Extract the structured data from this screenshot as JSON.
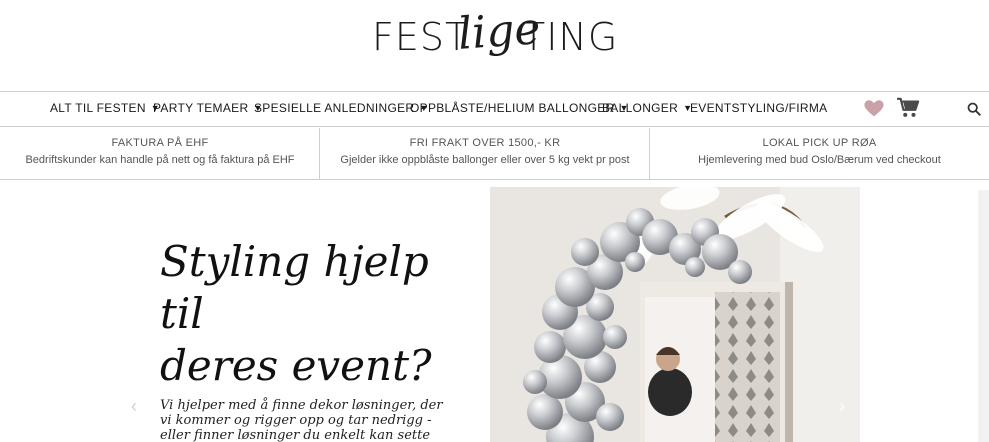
{
  "logo": {
    "part1": "FEST",
    "part2": "lige",
    "part3": "TING"
  },
  "nav": {
    "items": [
      {
        "label": "ALT TIL FESTEN",
        "caret": true
      },
      {
        "label": "PARTY TEMAER",
        "caret": true
      },
      {
        "label": "SPESIELLE ANLEDNINGER",
        "caret": true
      },
      {
        "label": "OPPBLÅSTE/HELIUM BALLONGER",
        "caret": true
      },
      {
        "label": "BALLONGER",
        "caret": true
      },
      {
        "label": "EVENTSTYLING/FIRMA",
        "caret": false
      }
    ],
    "icons": [
      "heart-icon",
      "cart-icon",
      "search-icon"
    ]
  },
  "info": [
    {
      "title": "FAKTURA PÅ EHF",
      "subtitle": "Bedriftskunder kan handle på nett og få faktura på EHF"
    },
    {
      "title": "FRI FRAKT OVER 1500,- KR",
      "subtitle": "Gjelder ikke oppblåste ballonger eller over 5 kg vekt pr post"
    },
    {
      "title": "LOKAL PICK UP RØA",
      "subtitle": "Hjemlevering med bud Oslo/Bærum ved checkout"
    }
  ],
  "hero": {
    "title_line1": "Styling hjelp til",
    "title_line2": "deres event?",
    "text": "Vi hjelper med å finne dekor løsninger, der vi kommer og rigger opp og tar nedrigg - eller finner løsninger du enkelt kan sette opp selv",
    "prev_arrow": "‹",
    "next_arrow": "›"
  },
  "colors": {
    "heart": "#c8a2a8",
    "cart": "#4a4a4a",
    "border": "#cfcfcf",
    "text": "#1a1a1a"
  }
}
